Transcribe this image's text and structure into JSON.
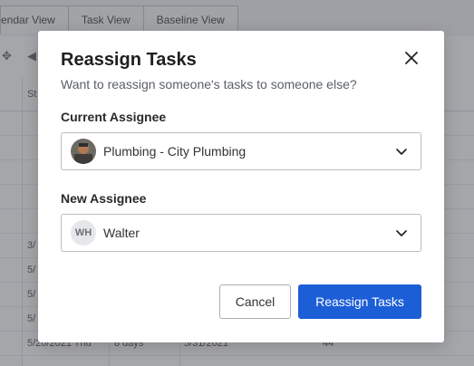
{
  "background": {
    "tabs": [
      "endar View",
      "Task View",
      "Baseline View"
    ],
    "grid_header": "St",
    "rows": [
      {
        "c1": "",
        "c2": "",
        "c3": "",
        "c4": ""
      },
      {
        "c1": "",
        "c2": "",
        "c3": "",
        "c4": ""
      },
      {
        "c1": "",
        "c2": "",
        "c3": "",
        "c4": ""
      },
      {
        "c1": "",
        "c2": "",
        "c3": "",
        "c4": ""
      },
      {
        "c1": "",
        "c2": "",
        "c3": "",
        "c4": ""
      },
      {
        "c1": "3/",
        "c2": "",
        "c3": "",
        "c4": ""
      },
      {
        "c1": "5/",
        "c2": "",
        "c3": "",
        "c4": ""
      },
      {
        "c1": "5/",
        "c2": "",
        "c3": "",
        "c4": ""
      },
      {
        "c1": "5/",
        "c2": "",
        "c3": "",
        "c4": ""
      },
      {
        "c1": "5/20/2021 Thu",
        "c2": "8 days",
        "c3": "5/31/2021",
        "c4": "44"
      }
    ]
  },
  "modal": {
    "title": "Reassign Tasks",
    "subtitle": "Want to reassign someone's tasks to someone else?",
    "current_label": "Current Assignee",
    "current_value": "Plumbing - City Plumbing",
    "new_label": "New Assignee",
    "new_avatar_initials": "WH",
    "new_value": "Walter",
    "cancel_label": "Cancel",
    "confirm_label": "Reassign Tasks"
  },
  "colors": {
    "primary": "#1c5ed6",
    "overlay": "rgba(40,44,52,0.42)"
  },
  "icons": {
    "close": "close-icon",
    "dropdown": "chevron-down-icon"
  }
}
